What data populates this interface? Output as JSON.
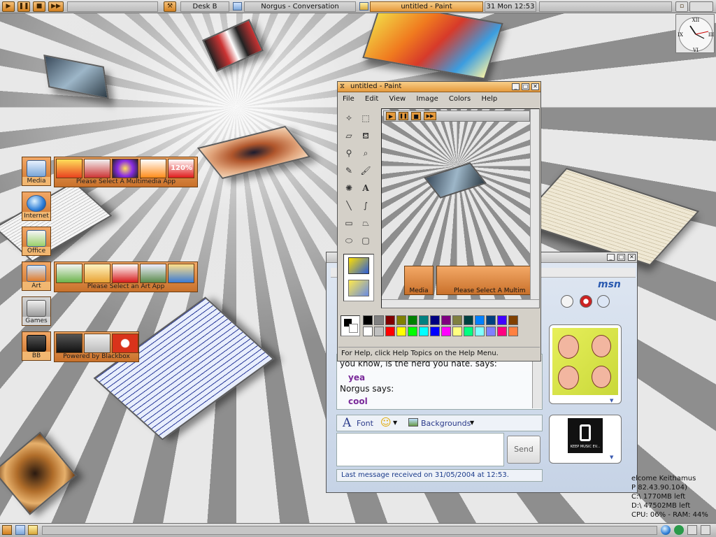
{
  "topbar": {
    "desk_label": "Desk B",
    "tasks": [
      "Norgus - Conversation",
      "untitled - Paint"
    ],
    "clock_text": "31 Mon 12:53"
  },
  "clock": {
    "numerals": [
      "XII",
      "III",
      "VI",
      "IX"
    ]
  },
  "launcher": {
    "categories": [
      {
        "label": "Media"
      },
      {
        "label": "Internet"
      },
      {
        "label": "Office"
      },
      {
        "label": "Art"
      },
      {
        "label": "Games"
      },
      {
        "label": "BB"
      }
    ],
    "strips": [
      {
        "text": "Please Select A Multimedia App",
        "badge": "120%"
      },
      {
        "text": "Please Select an Art App"
      },
      {
        "text": "Powered by Blackbox"
      }
    ]
  },
  "paint": {
    "title": "untitled - Paint",
    "menu": [
      "File",
      "Edit",
      "View",
      "Image",
      "Colors",
      "Help"
    ],
    "status": "For Help, click Help Topics on the Help Menu.",
    "canvas_strip_text": "Please Select A Multim",
    "canvas_media_label": "Media",
    "palette": [
      "#000000",
      "#808080",
      "#800000",
      "#808000",
      "#008000",
      "#008080",
      "#000080",
      "#800080",
      "#808040",
      "#004040",
      "#0080ff",
      "#004080",
      "#4000ff",
      "#804000",
      "#ffffff",
      "#c0c0c0",
      "#ff0000",
      "#ffff00",
      "#00ff00",
      "#00ffff",
      "#0000ff",
      "#ff00ff",
      "#ffff80",
      "#00ff80",
      "#80ffff",
      "#8080ff",
      "#ff0080",
      "#ff8040"
    ]
  },
  "msn": {
    "logo": "msn",
    "messages": [
      {
        "text": "you know, is the nerd you hate. says:",
        "style": "plain"
      },
      {
        "text": "yea",
        "style": "purple"
      },
      {
        "text": "Norgus says:",
        "style": "plain"
      },
      {
        "text": "cool",
        "style": "purple"
      }
    ],
    "font_label": "Font",
    "backgrounds_label": "Backgrounds",
    "send_label": "Send",
    "last_message": "Last message received on 31/05/2004 at 12:53.",
    "avatar_label": "KEEP MUSIC EV..."
  },
  "sysinfo": {
    "lines": [
      "elcome Keithamus",
      "P 82.43.90.104)",
      "C:\\ 1770MB left",
      "D:\\ 47502MB left",
      "CPU: 06% - RAM: 44%"
    ]
  }
}
